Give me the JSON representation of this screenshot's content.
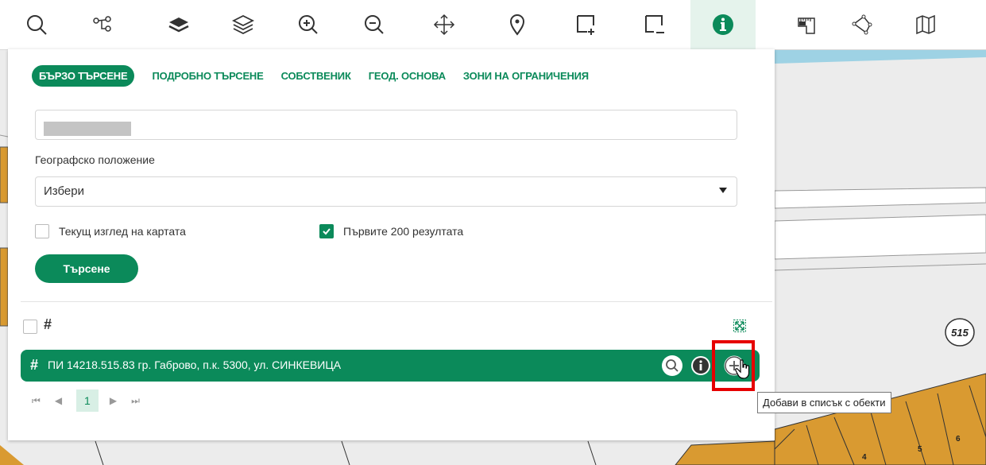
{
  "toolbar": {
    "buttons": [
      {
        "icon": "search-icon"
      },
      {
        "icon": "route-icon"
      },
      {
        "icon": "layers-filled-icon"
      },
      {
        "icon": "layers-outline-icon"
      },
      {
        "icon": "zoom-in-icon"
      },
      {
        "icon": "zoom-out-icon"
      },
      {
        "icon": "pan-icon"
      },
      {
        "icon": "location-pin-icon"
      },
      {
        "icon": "select-add-icon"
      },
      {
        "icon": "select-remove-icon"
      },
      {
        "icon": "info-icon",
        "active": true
      },
      {
        "icon": "measure-icon"
      },
      {
        "icon": "polygon-icon"
      },
      {
        "icon": "map-icon"
      }
    ]
  },
  "tabs": [
    "БЪРЗО ТЪРСЕНЕ",
    "ПОДРОБНО ТЪРСЕНЕ",
    "СОБСТВЕНИК",
    "ГЕОД. ОСНОВА",
    "ЗОНИ НА ОГРАНИЧЕНИЯ"
  ],
  "form": {
    "search_value": "",
    "geo_label": "Географско положение",
    "geo_select_value": "Избери",
    "current_view_label": "Текущ изглед на картата",
    "current_view_checked": false,
    "first200_label": "Първите 200 резултата",
    "first200_checked": true,
    "search_button": "Търсене"
  },
  "results": {
    "select_all_checked": false,
    "items": [
      {
        "label": "ПИ 14218.515.83 гр. Габрово, п.к. 5300, ул. СИНКЕВИЦА"
      }
    ]
  },
  "pager": {
    "current": "1"
  },
  "tooltip": "Добави в списък с обекти",
  "map": {
    "labels": [
      "515",
      "4",
      "5",
      "6"
    ],
    "parcel_color": "#d99a31",
    "water_color": "#9ed2e4",
    "road_color": "#ffffff"
  },
  "colors": {
    "accent": "#0b8a5a",
    "highlight": "#e60000"
  }
}
